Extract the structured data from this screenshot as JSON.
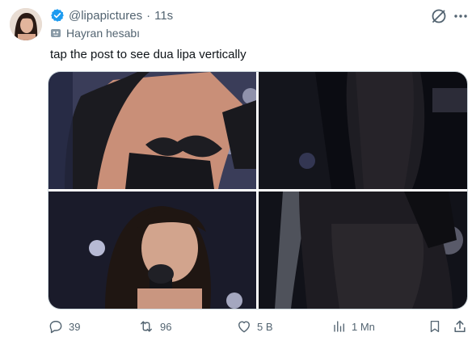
{
  "author": {
    "handle": "@lipapictures",
    "separator": "·",
    "time": "11s",
    "label": "Hayran hesabı"
  },
  "post": {
    "text": "tap the post to see dua lipa vertically"
  },
  "media": {
    "images": [
      {
        "icon": "photo-top-left"
      },
      {
        "icon": "photo-top-right"
      },
      {
        "icon": "photo-bottom-left"
      },
      {
        "icon": "photo-bottom-right"
      }
    ]
  },
  "actions": {
    "replies": "39",
    "reposts": "96",
    "likes": "5 B",
    "views": "1 Mn"
  },
  "colors": {
    "text": "#0f1419",
    "secondary": "#536471",
    "verified": "#1d9bf0",
    "border": "#cfd9de"
  }
}
